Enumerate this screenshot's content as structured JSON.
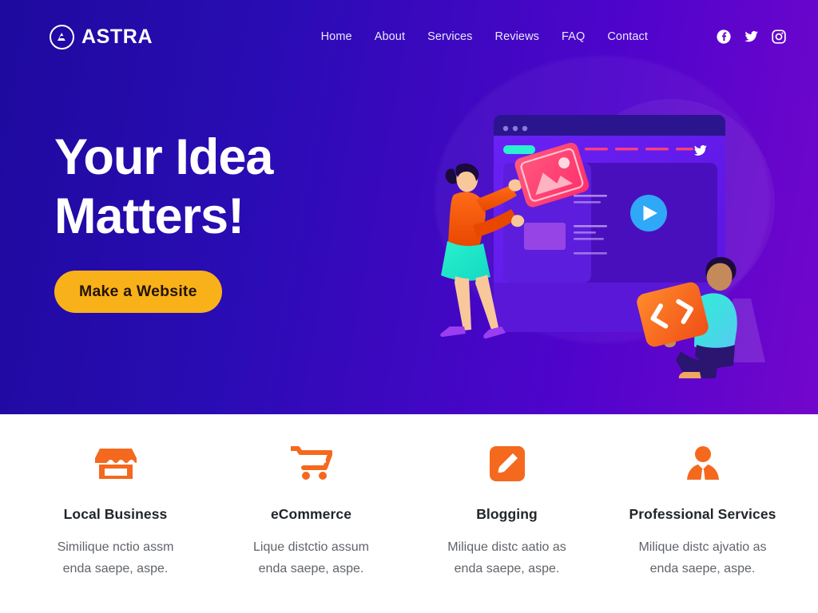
{
  "brand": {
    "name": "ASTRA",
    "logo_icon": "astra-circle-logo-icon"
  },
  "nav": {
    "items": [
      {
        "label": "Home"
      },
      {
        "label": "About"
      },
      {
        "label": "Services"
      },
      {
        "label": "Reviews"
      },
      {
        "label": "FAQ"
      },
      {
        "label": "Contact"
      }
    ],
    "socials": [
      {
        "name": "facebook-icon"
      },
      {
        "name": "twitter-icon"
      },
      {
        "name": "instagram-icon"
      }
    ]
  },
  "hero": {
    "title": "Your Idea\nMatters!",
    "cta_label": "Make a Website",
    "gradient_start": "#1E0A9E",
    "gradient_end": "#7306CC",
    "cta_color": "#F9B119"
  },
  "illustration": {
    "alt": "two people assembling a website on a large browser window",
    "play_button_color": "#2EA8F7",
    "code_card_label": "</>",
    "accent_orange": "#F4691E",
    "accent_teal": "#18E3C8"
  },
  "features": {
    "accent_color": "#F4691E",
    "cards": [
      {
        "icon": "store-icon",
        "title": "Local Business",
        "desc": "Similique nctio assm\nenda saepe, aspe."
      },
      {
        "icon": "shopping-cart-icon",
        "title": "eCommerce",
        "desc": "Lique distctio assum\nenda saepe, aspe."
      },
      {
        "icon": "pencil-edit-icon",
        "title": "Blogging",
        "desc": "Milique distc aatio as\nenda saepe, aspe."
      },
      {
        "icon": "business-person-icon",
        "title": "Professional Services",
        "desc": "Milique distc ajvatio as\nenda saepe, aspe."
      }
    ]
  }
}
